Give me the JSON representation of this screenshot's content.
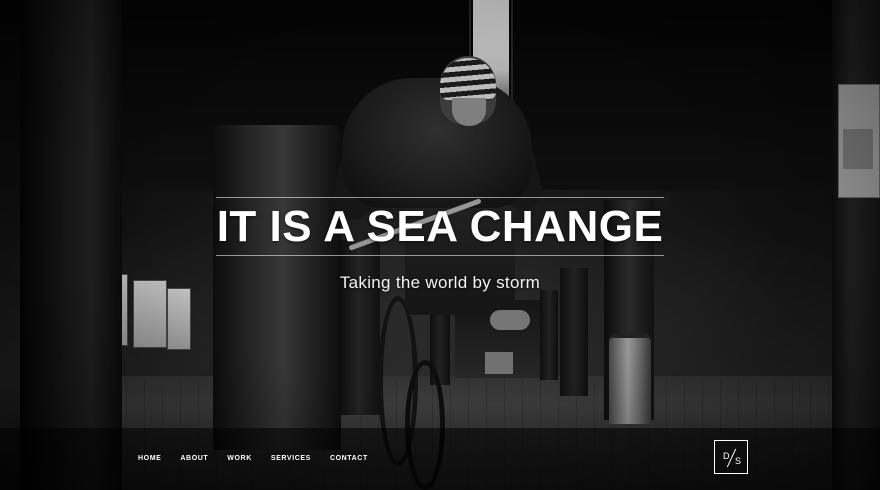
{
  "hero": {
    "headline": "IT IS A SEA CHANGE",
    "subtitle": "Taking the world by storm",
    "background_description_icon": "bmx-rider-photo"
  },
  "nav": {
    "items": [
      {
        "label": "HOME"
      },
      {
        "label": "ABOUT"
      },
      {
        "label": "WORK"
      },
      {
        "label": "SERVICES"
      },
      {
        "label": "CONTACT"
      }
    ]
  },
  "logo": {
    "left": "D",
    "right": "S"
  },
  "colors": {
    "text": "#ffffff",
    "navbar": "#000000",
    "background": "#050505"
  }
}
